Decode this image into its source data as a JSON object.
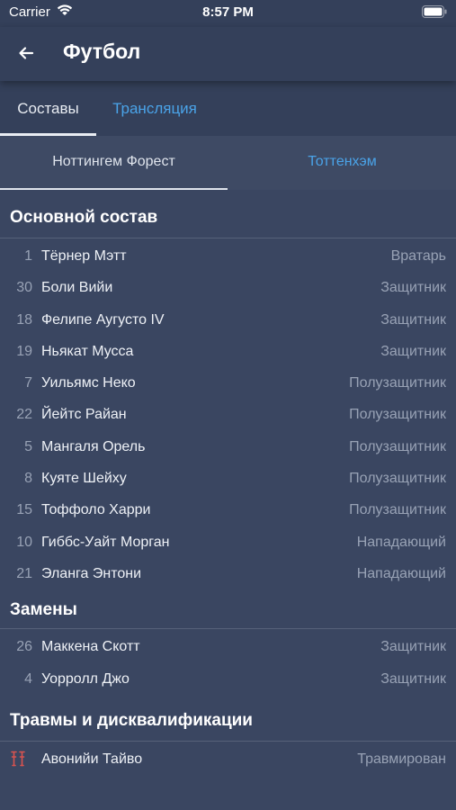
{
  "status_bar": {
    "carrier": "Carrier",
    "time": "8:57 PM"
  },
  "header": {
    "title": "Футбол"
  },
  "main_tabs": [
    {
      "label": "Составы"
    },
    {
      "label": "Трансляция"
    }
  ],
  "team_tabs": [
    {
      "label": "Ноттингем Форест"
    },
    {
      "label": "Тоттенхэм"
    }
  ],
  "sections": {
    "starting": {
      "title": "Основной состав",
      "players": [
        {
          "number": "1",
          "name": "Тёрнер Мэтт",
          "position": "Вратарь"
        },
        {
          "number": "30",
          "name": "Боли Вийи",
          "position": "Защитник"
        },
        {
          "number": "18",
          "name": "Фелипе Аугусто IV",
          "position": "Защитник"
        },
        {
          "number": "19",
          "name": "Ньякат Мусса",
          "position": "Защитник"
        },
        {
          "number": "7",
          "name": "Уильямс Неко",
          "position": "Полузащитник"
        },
        {
          "number": "22",
          "name": "Йейтс Райан",
          "position": "Полузащитник"
        },
        {
          "number": "5",
          "name": "Мангаля Орель",
          "position": "Полузащитник"
        },
        {
          "number": "8",
          "name": "Куяте Шейху",
          "position": "Полузащитник"
        },
        {
          "number": "15",
          "name": "Тоффоло Харри",
          "position": "Полузащитник"
        },
        {
          "number": "10",
          "name": "Гиббс-Уайт Морган",
          "position": "Нападающий"
        },
        {
          "number": "21",
          "name": "Эланга Энтони",
          "position": "Нападающий"
        }
      ]
    },
    "subs": {
      "title": "Замены",
      "players": [
        {
          "number": "26",
          "name": "Маккена Скотт",
          "position": "Защитник"
        },
        {
          "number": "4",
          "name": "Уорролл Джо",
          "position": "Защитник"
        }
      ]
    },
    "injuries": {
      "title": "Травмы и дисквалификации",
      "players": [
        {
          "icon": "injury-crutches-icon",
          "name": "Авонийи Тайво",
          "position": "Травмирован"
        }
      ]
    }
  },
  "colors": {
    "background": "#3a4661",
    "accent": "#4aa3e8",
    "injury": "#d9534f"
  }
}
